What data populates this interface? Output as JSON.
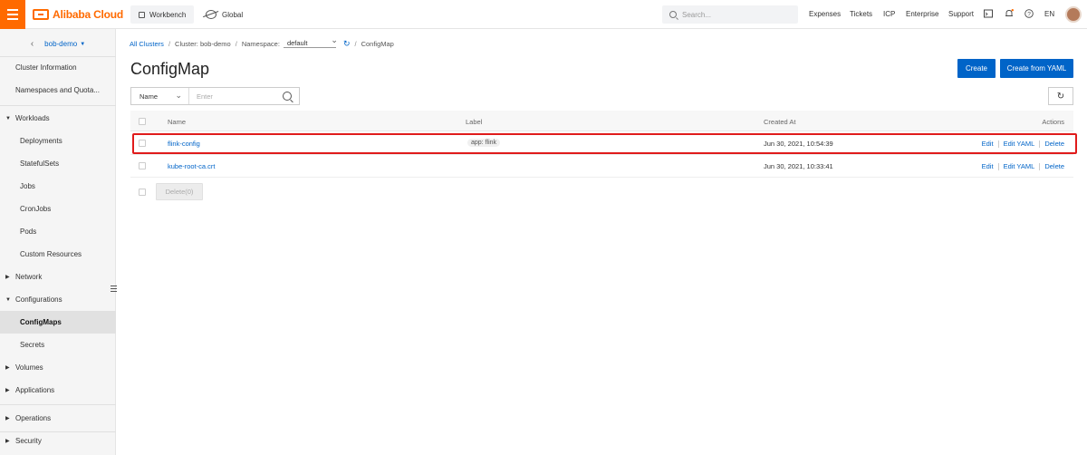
{
  "topbar": {
    "brand": "Alibaba Cloud",
    "workbench": "Workbench",
    "region": "Global",
    "search_placeholder": "Search...",
    "links": [
      "Expenses",
      "Tickets",
      "ICP",
      "Enterprise",
      "Support"
    ],
    "language": "EN",
    "brand_color": "#ff6a00"
  },
  "sidebar": {
    "cluster": "bob-demo",
    "items": [
      {
        "label": "Cluster Information"
      },
      {
        "label": "Namespaces and Quota..."
      },
      {
        "label": "Workloads"
      },
      {
        "label": "Deployments"
      },
      {
        "label": "StatefulSets"
      },
      {
        "label": "Jobs"
      },
      {
        "label": "CronJobs"
      },
      {
        "label": "Pods"
      },
      {
        "label": "Custom Resources"
      },
      {
        "label": "Network"
      },
      {
        "label": "Configurations"
      },
      {
        "label": "ConfigMaps"
      },
      {
        "label": "Secrets"
      },
      {
        "label": "Volumes"
      },
      {
        "label": "Applications"
      },
      {
        "label": "Operations"
      },
      {
        "label": "Security"
      }
    ]
  },
  "breadcrumb": {
    "all_clusters": "All Clusters",
    "cluster": "Cluster: bob-demo",
    "namespace_label": "Namespace:",
    "namespace_value": "default",
    "current": "ConfigMap"
  },
  "page": {
    "title": "ConfigMap",
    "create": "Create",
    "create_yaml": "Create from YAML",
    "filter_field": "Name",
    "filter_placeholder": "Enter"
  },
  "table": {
    "headers": {
      "name": "Name",
      "label": "Label",
      "created": "Created At",
      "actions": "Actions"
    },
    "rows": [
      {
        "name": "flink-config",
        "label": "app: flink",
        "created": "Jun 30, 2021, 10:54:39"
      },
      {
        "name": "kube-root-ca.crt",
        "label": "",
        "created": "Jun 30, 2021, 10:33:41"
      }
    ],
    "actions": {
      "edit": "Edit",
      "edit_yaml": "Edit YAML",
      "delete": "Delete"
    },
    "bulk_delete": "Delete(0)"
  }
}
